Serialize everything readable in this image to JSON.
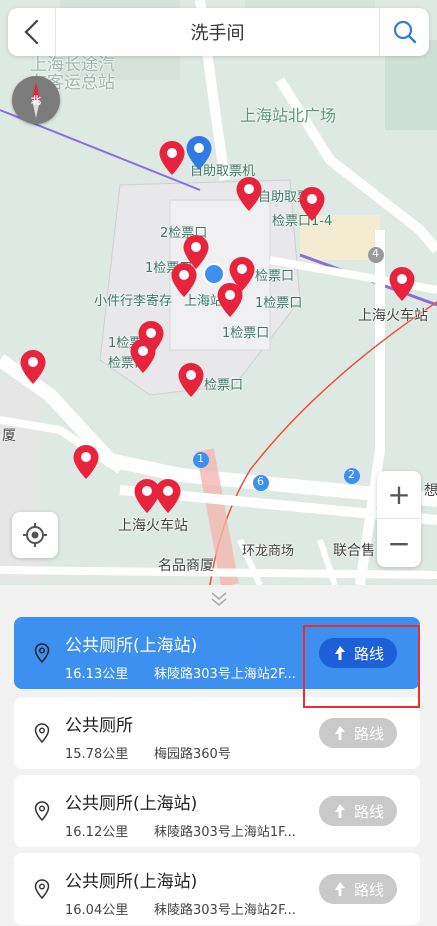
{
  "header": {
    "title": "洗手间",
    "back_icon": "back-arrow-icon",
    "search_icon": "search-icon"
  },
  "map": {
    "compass_label": "北",
    "labels": {
      "north_square": "上海站北广场",
      "long_distance_1": "上海长途汽",
      "long_distance_2": "车客运总站",
      "self_ticket": "自助取票机",
      "self_ticket_2": "自助取票",
      "gate_1_4": "检票口1-4",
      "gate_2": "2检票口",
      "gate_1a": "1检票口",
      "gate_1b": "1检票口",
      "gate_1c": "1检票口",
      "gate_1d": "1检票口",
      "gate_a": "检票口",
      "gate_b": "检票口",
      "luggage": "小件行李寄存",
      "shanghai_station_short": "上海站",
      "shanghai_station_right": "上海火车站",
      "shanghai_station_bottom": "上海火车站",
      "huanlong": "环龙商场",
      "lianhe": "联合售",
      "mingpin": "名品商厦",
      "xia": "厦",
      "xiang": "想",
      "road_number_4": "4",
      "route_1": "1",
      "route_2": "2",
      "route_6": "6"
    },
    "pin_color": "#e8233e",
    "poi_color": "#2f7be6",
    "zoom_in_label": "+",
    "zoom_out_label": "−"
  },
  "results": [
    {
      "name": "公共厕所(上海站)",
      "distance": "16.13公里",
      "address": "秣陵路303号上海站2F...",
      "route_label": "路线",
      "active": true
    },
    {
      "name": "公共厕所",
      "distance": "15.78公里",
      "address": "梅园路360号",
      "route_label": "路线",
      "active": false
    },
    {
      "name": "公共厕所(上海站)",
      "distance": "16.12公里",
      "address": "秣陵路303号上海站1F...",
      "route_label": "路线",
      "active": false
    },
    {
      "name": "公共厕所(上海站)",
      "distance": "16.04公里",
      "address": "秣陵路303号上海站2F...",
      "route_label": "路线",
      "active": false
    }
  ],
  "colors": {
    "accent": "#3d8ff0",
    "route_primary": "#1d5fd6",
    "route_disabled": "#c9c9c9",
    "highlight": "#e8302e"
  }
}
